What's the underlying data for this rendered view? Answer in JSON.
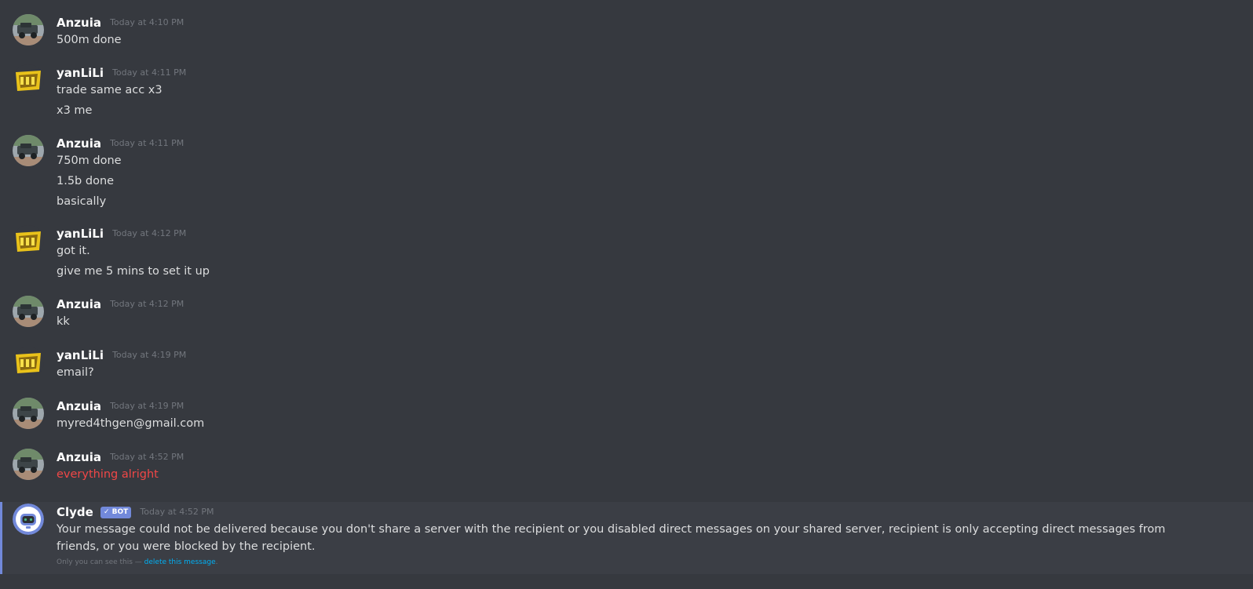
{
  "messages": [
    {
      "author": "Anzuia",
      "time": "Today at 4:10 PM",
      "avatar": "truck-avatar",
      "lines": [
        "500m done"
      ]
    },
    {
      "author": "yanLiLi",
      "time": "Today at 4:11 PM",
      "avatar": "yanlili-logo-avatar",
      "lines": [
        "trade same acc x3",
        "x3 me"
      ]
    },
    {
      "author": "Anzuia",
      "time": "Today at 4:11 PM",
      "avatar": "truck-avatar",
      "lines": [
        "750m done",
        "1.5b done",
        "basically"
      ]
    },
    {
      "author": "yanLiLi",
      "time": "Today at 4:12 PM",
      "avatar": "yanlili-logo-avatar",
      "lines": [
        "got it.",
        "give me 5 mins to set it up"
      ]
    },
    {
      "author": "Anzuia",
      "time": "Today at 4:12 PM",
      "avatar": "truck-avatar",
      "lines": [
        "kk"
      ]
    },
    {
      "author": "yanLiLi",
      "time": "Today at 4:19 PM",
      "avatar": "yanlili-logo-avatar",
      "lines": [
        "email?"
      ]
    },
    {
      "author": "Anzuia",
      "time": "Today at 4:19 PM",
      "avatar": "truck-avatar",
      "lines": [
        "myred4thgen@gmail.com"
      ]
    },
    {
      "author": "Anzuia",
      "time": "Today at 4:52 PM",
      "avatar": "truck-avatar",
      "lines": [
        "everything alright"
      ],
      "failed": true
    }
  ],
  "clyde": {
    "author": "Clyde",
    "badge": "✓ BOT",
    "time": "Today at 4:52 PM",
    "avatar": "clyde-robot-avatar",
    "text": "Your message could not be delivered because you don't share a server with the recipient or you disabled direct messages on your shared server, recipient is only accepting direct messages from friends, or you were blocked by the recipient.",
    "ephemeral_prefix": "Only you can see this — ",
    "ephemeral_link": "delete this message",
    "ephemeral_suffix": "."
  },
  "colors": {
    "background": "#36393f",
    "username": "#ffffff",
    "timestamp": "#72767d",
    "text": "#dcddde",
    "error": "#f04747",
    "bot_badge": "#7289da",
    "link": "#00b0f4"
  }
}
